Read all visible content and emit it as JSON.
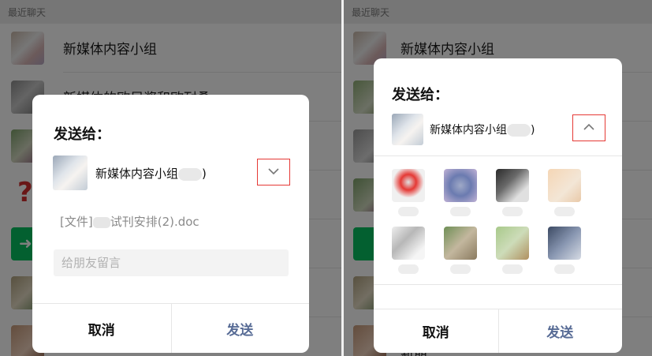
{
  "left": {
    "section_header": "最近聊天",
    "chats": [
      {
        "name": "新媒体内容小组"
      },
      {
        "name": "新媒体的欧尼酱和欧耐桑"
      }
    ],
    "dialog": {
      "title": "发送给：",
      "recipient_name": "新媒体内容小组",
      "recipient_suffix": ")",
      "file_prefix": "[文件]",
      "file_name": "试刊安排(2).doc",
      "message_placeholder": "给朋友留言",
      "cancel_label": "取消",
      "send_label": "发送"
    }
  },
  "right": {
    "section_header": "最近聊天",
    "chats": [
      {
        "name": "新媒体内容小组"
      }
    ],
    "partial_bottom_text": "新朋",
    "dialog": {
      "title": "发送给：",
      "recipient_name": "新媒体内容小组",
      "recipient_suffix": ")",
      "cancel_label": "取消",
      "send_label": "发送"
    }
  },
  "colors": {
    "send_blue": "#576b95",
    "highlight_red": "#e53935",
    "wechat_green": "#07c160"
  },
  "icons": {
    "collapsed_toggle": "chevron-down-icon",
    "expanded_toggle": "chevron-up-icon"
  }
}
